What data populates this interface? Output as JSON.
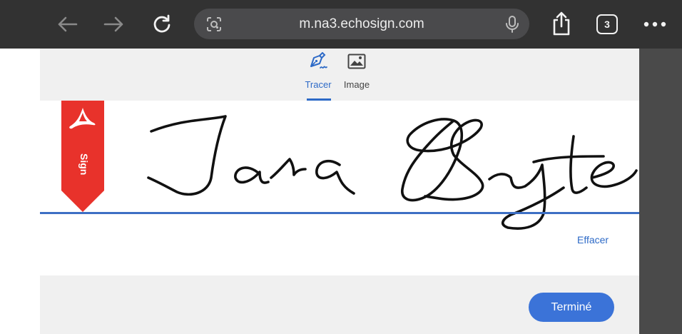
{
  "browser": {
    "url": "m.na3.echosign.com",
    "tab_count": "3",
    "icons": {
      "back": "arrow-left-icon",
      "forward": "arrow-right-icon",
      "reload": "reload-icon",
      "lens": "lens-search-icon",
      "mic": "microphone-icon",
      "share": "share-icon",
      "more": "more-dots-icon"
    }
  },
  "dialog": {
    "tabs": [
      {
        "label": "Tracer",
        "icon": "pen-draw-icon",
        "active": true
      },
      {
        "label": "Image",
        "icon": "image-icon",
        "active": false
      }
    ],
    "sign_flag": {
      "label": "Sign",
      "logo": "adobe-acrobat-logo",
      "color": "#e8322b"
    },
    "signature_text": "Jara Byte",
    "clear_label": "Effacer",
    "done_label": "Terminé"
  },
  "colors": {
    "accent": "#2d6ac7",
    "button": "#3b73d8",
    "toolbar": "#323232",
    "flag": "#e8322b"
  }
}
